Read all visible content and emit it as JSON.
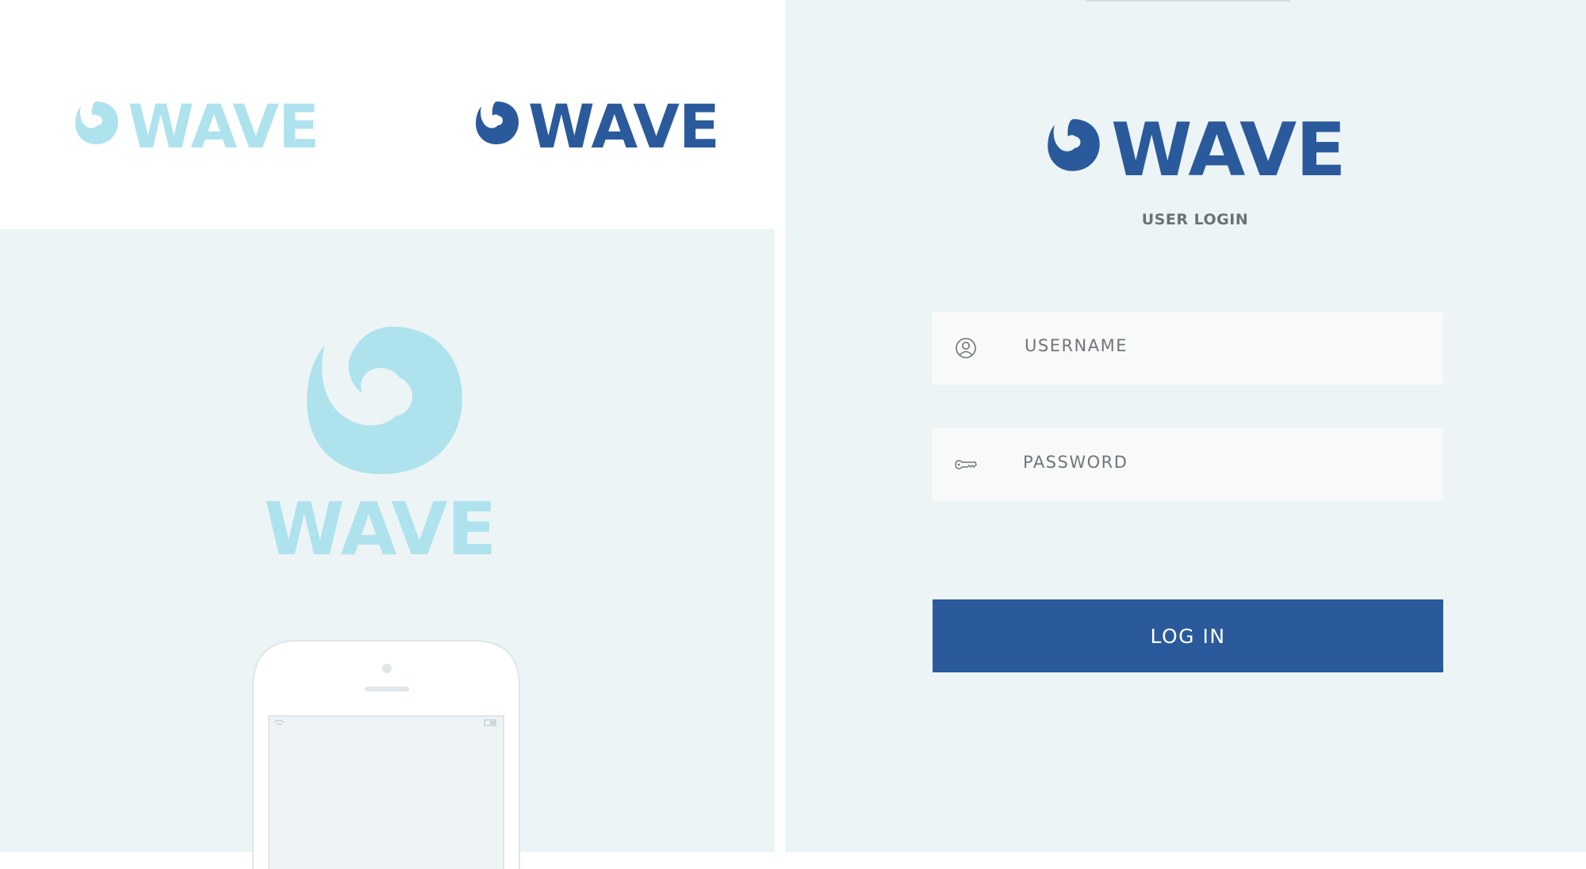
{
  "brand": {
    "name": "WAVE",
    "colors": {
      "light": "#aee3ee",
      "dark": "#2a5a9b",
      "panel": "#edf4f6"
    }
  },
  "login": {
    "title": "USER LOGIN",
    "username_placeholder": "USERNAME",
    "password_placeholder": "PASSWORD",
    "submit_label": "LOG IN",
    "icons": {
      "username": "user-icon",
      "password": "key-icon"
    }
  }
}
